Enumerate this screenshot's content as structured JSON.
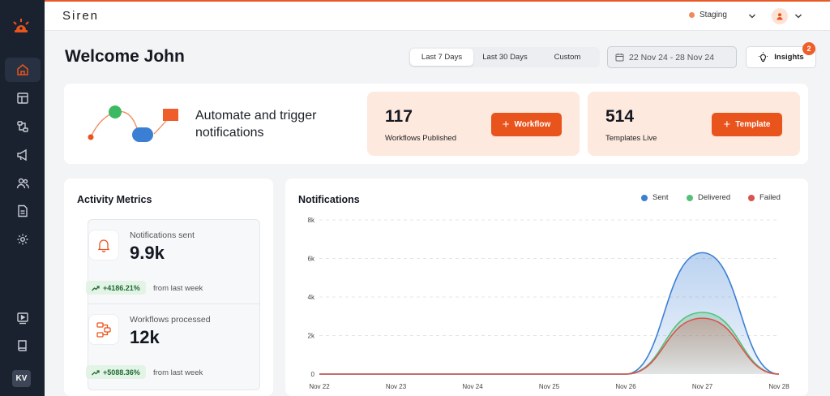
{
  "app": {
    "brand": "Siren"
  },
  "sidebar": {
    "items": [
      {
        "icon": "home-icon",
        "active": true
      },
      {
        "icon": "layout-icon",
        "active": false
      },
      {
        "icon": "workflow-icon",
        "active": false
      },
      {
        "icon": "megaphone-icon",
        "active": false
      },
      {
        "icon": "users-icon",
        "active": false
      },
      {
        "icon": "document-icon",
        "active": false
      },
      {
        "icon": "settings-icon",
        "active": false
      },
      {
        "icon": "video-icon",
        "active": false
      },
      {
        "icon": "book-icon",
        "active": false
      }
    ],
    "avatar_initials": "KV"
  },
  "topbar": {
    "environment": "Staging",
    "environment_color": "#f08a5d"
  },
  "header": {
    "greeting": "Welcome John",
    "ranges": [
      "Last 7 Days",
      "Last 30 Days",
      "Custom"
    ],
    "selected_range": "Last 7 Days",
    "date_range": "22 Nov 24 - 28 Nov 24",
    "insights_label": "Insights",
    "insights_badge": "2"
  },
  "hero": {
    "text": "Automate and trigger notifications",
    "workflows": {
      "value": "117",
      "label": "Workflows Published",
      "button": "Workflow"
    },
    "templates": {
      "value": "514",
      "label": "Templates Live",
      "button": "Template"
    }
  },
  "metrics": {
    "title": "Activity Metrics",
    "cards": [
      {
        "label": "Notifications sent",
        "value": "9.9k",
        "change": "+4186.21%",
        "from": "from last week",
        "icon": "bell-icon"
      },
      {
        "label": "Workflows processed",
        "value": "12k",
        "change": "+5088.36%",
        "from": "from last week",
        "icon": "flow-icon"
      }
    ]
  },
  "notifications": {
    "title": "Notifications",
    "legend": [
      {
        "name": "Sent",
        "color": "#3b7fd4"
      },
      {
        "name": "Delivered",
        "color": "#55c07a"
      },
      {
        "name": "Failed",
        "color": "#d9534f"
      }
    ]
  },
  "chart_data": {
    "type": "area",
    "title": "Notifications",
    "categories": [
      "Nov 22",
      "Nov 23",
      "Nov 24",
      "Nov 25",
      "Nov 26",
      "Nov 27",
      "Nov 28"
    ],
    "y_ticks": [
      "0",
      "2k",
      "4k",
      "6k",
      "8k"
    ],
    "ylim": [
      0,
      8000
    ],
    "grid": true,
    "legend_position": "top-right",
    "series": [
      {
        "name": "Sent",
        "color": "#3b7fd4",
        "values": [
          0,
          0,
          0,
          0,
          0,
          6300,
          0
        ]
      },
      {
        "name": "Delivered",
        "color": "#55c07a",
        "values": [
          0,
          0,
          0,
          0,
          0,
          3200,
          0
        ]
      },
      {
        "name": "Failed",
        "color": "#d9534f",
        "values": [
          0,
          0,
          0,
          0,
          0,
          2900,
          0
        ]
      }
    ]
  }
}
